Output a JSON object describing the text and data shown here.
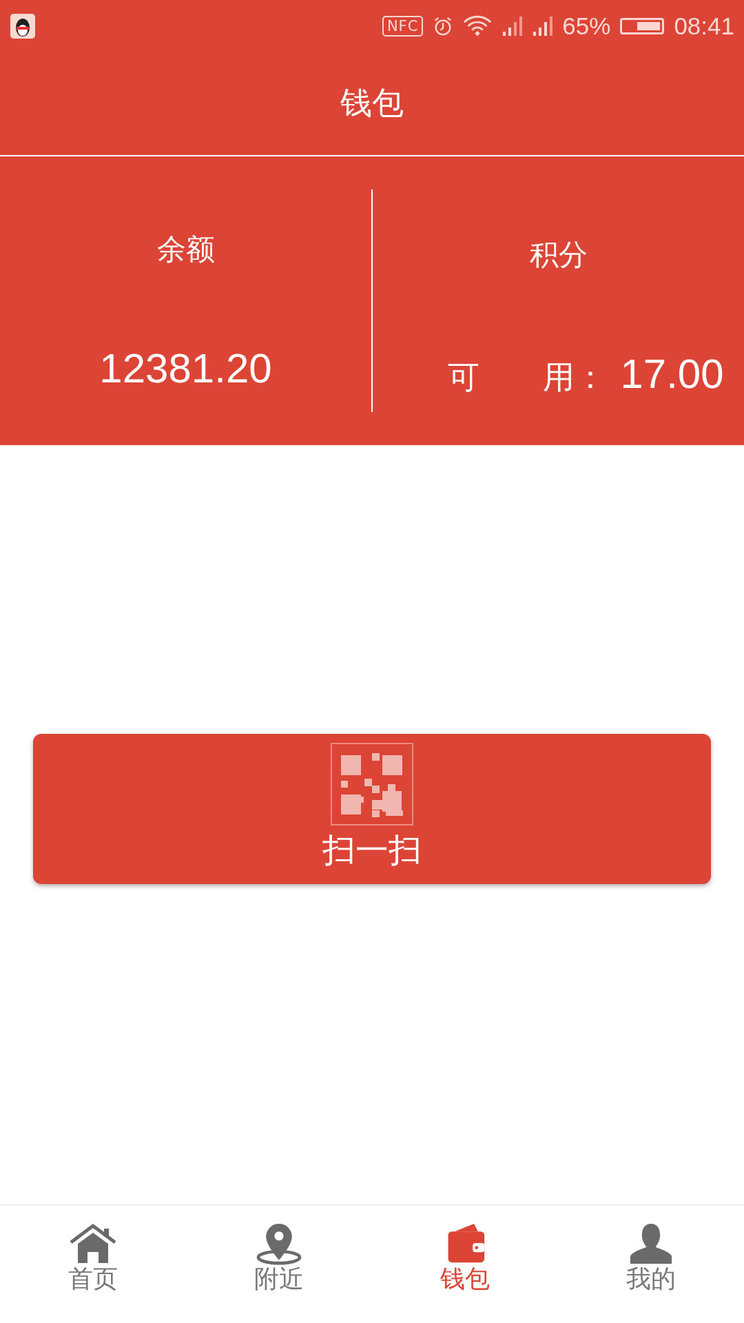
{
  "status_bar": {
    "nfc": "NFC",
    "battery_percent": "65%",
    "battery": {
      "level": 0.65
    },
    "time": "08:41"
  },
  "header": {
    "title": "钱包"
  },
  "balance": {
    "label": "余额",
    "value": "12381.20"
  },
  "points": {
    "label": "积分",
    "available_label": "可　　用：",
    "value": "17.00"
  },
  "scan_button": {
    "label": "扫一扫"
  },
  "bottom_nav": [
    {
      "kind": "home",
      "label": "首页",
      "selected": false
    },
    {
      "kind": "nearby",
      "label": "附近",
      "selected": false
    },
    {
      "kind": "wallet",
      "label": "钱包",
      "selected": true
    },
    {
      "kind": "profile",
      "label": "我的",
      "selected": false
    }
  ]
}
